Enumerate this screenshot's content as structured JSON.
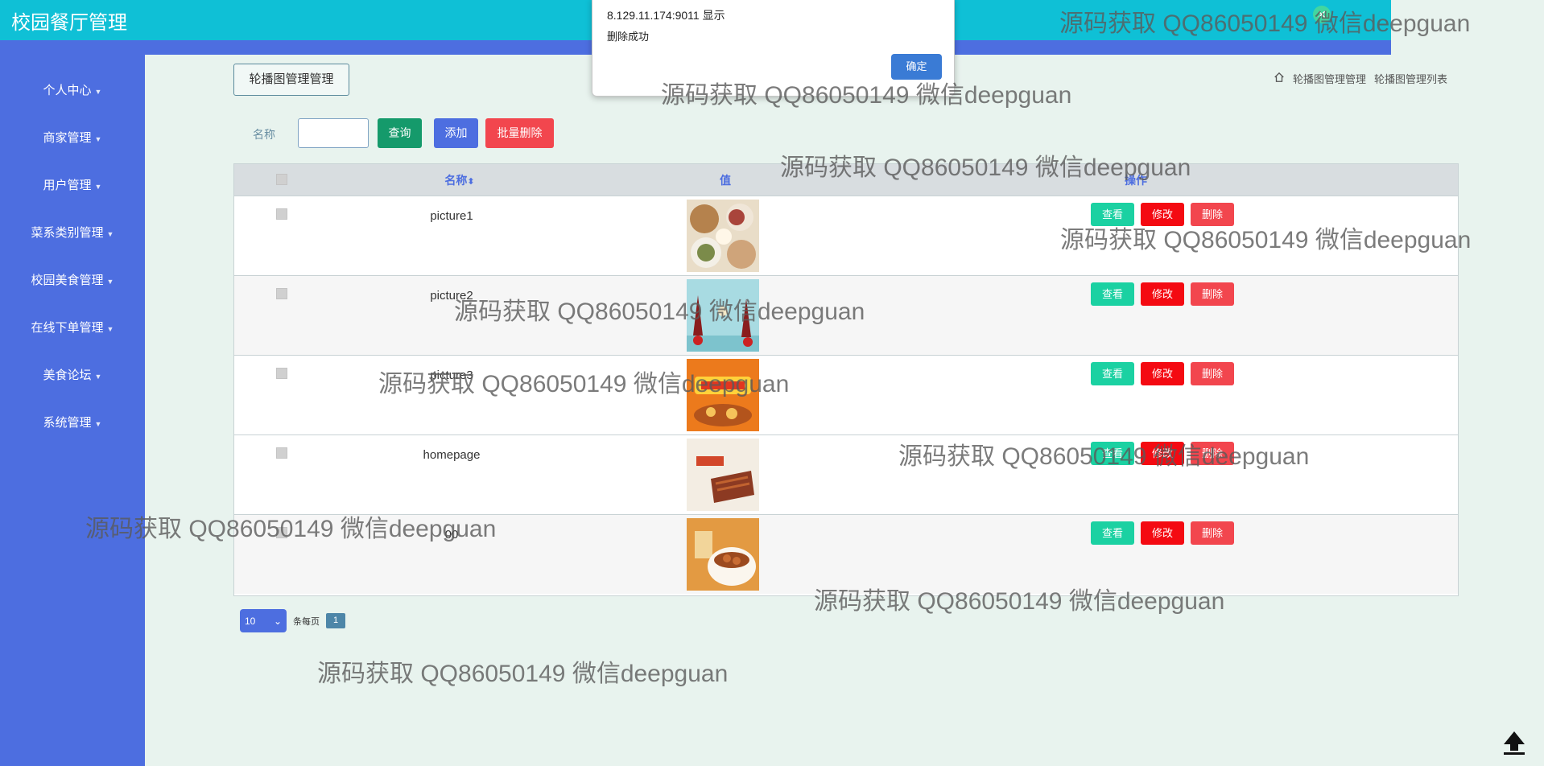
{
  "app": {
    "title": "校园餐厅管理"
  },
  "sidebar": {
    "items": [
      {
        "label": "个人中心"
      },
      {
        "label": "商家管理"
      },
      {
        "label": "用户管理"
      },
      {
        "label": "菜系类别管理"
      },
      {
        "label": "校园美食管理"
      },
      {
        "label": "在线下单管理"
      },
      {
        "label": "美食论坛"
      },
      {
        "label": "系统管理"
      }
    ]
  },
  "header": {
    "section_button": "轮播图管理管理"
  },
  "breadcrumb": {
    "items": [
      "轮播图管理管理",
      "轮播图管理列表"
    ]
  },
  "search": {
    "label": "名称",
    "value": "",
    "query_label": "查询",
    "add_label": "添加",
    "batch_delete_label": "批量删除"
  },
  "table": {
    "headers": {
      "name": "名称",
      "sort_icon": "⬍",
      "value": "值",
      "actions": "操作"
    },
    "rows": [
      {
        "name": "picture1",
        "image": "food-plates"
      },
      {
        "name": "picture2",
        "image": "festive-teal"
      },
      {
        "name": "picture3",
        "image": "orange-banner"
      },
      {
        "name": "homepage",
        "image": "meat-skewers"
      },
      {
        "name": "00",
        "image": "bowl-dish"
      }
    ],
    "action_labels": {
      "view": "查看",
      "edit": "修改",
      "delete": "删除"
    }
  },
  "pagination": {
    "page_size": "10",
    "per_page_label": "条每页",
    "current_page": "1"
  },
  "dialog": {
    "title": "8.129.11.174:9011 显示",
    "message": "删除成功",
    "ok_label": "确定"
  },
  "watermark": {
    "text": "源码获取 QQ86050149 微信deepguan"
  },
  "colors": {
    "topbar": "#0fc0d6",
    "sidebar": "#4d6ee0",
    "view": "#1bd1a2",
    "edit": "#f40a12",
    "delete": "#f2464e"
  }
}
